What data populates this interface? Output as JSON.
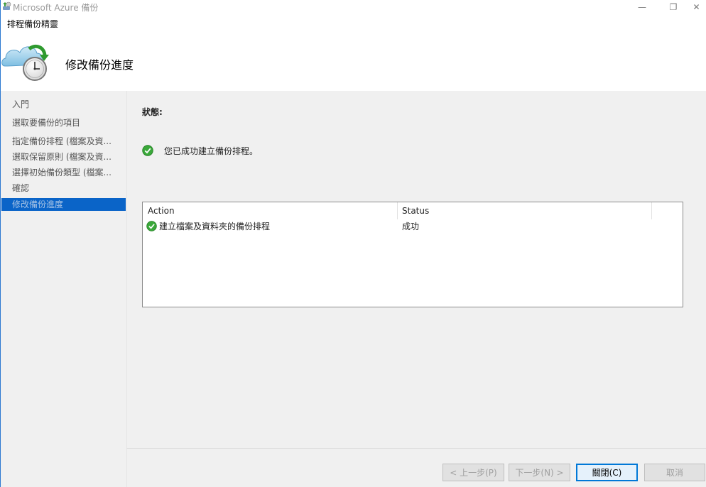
{
  "window": {
    "title": "Microsoft Azure 備份"
  },
  "titlebar_buttons": {
    "minimize": "—",
    "restore": "❐",
    "close": "✕"
  },
  "wizard": {
    "name": "排程備份精靈",
    "page_title": "修改備份進度"
  },
  "nav": {
    "items": [
      {
        "label": "入門"
      },
      {
        "label": "選取要備份的項目"
      },
      {
        "label": "指定備份排程 (檔案及資..."
      },
      {
        "label": "選取保留原則 (檔案及資..."
      },
      {
        "label": "選擇初始備份類型 (檔案..."
      },
      {
        "label": "確認"
      },
      {
        "label": "修改備份進度",
        "active": true
      }
    ]
  },
  "main": {
    "status_label": "狀態:",
    "success_message": "您已成功建立備份排程。",
    "results": {
      "columns": [
        "Action",
        "Status"
      ],
      "rows": [
        {
          "action": "建立檔案及資料夾的備份排程",
          "status": "成功"
        }
      ]
    }
  },
  "footer": {
    "prev_label": "< 上一步(P)",
    "next_label": "下一步(N) >",
    "close_label": "關閉(C)",
    "cancel_label": "取消"
  },
  "colors": {
    "accent": "#0a64c8",
    "success": "#2e9b2e",
    "window_border": "#2b78d0"
  }
}
